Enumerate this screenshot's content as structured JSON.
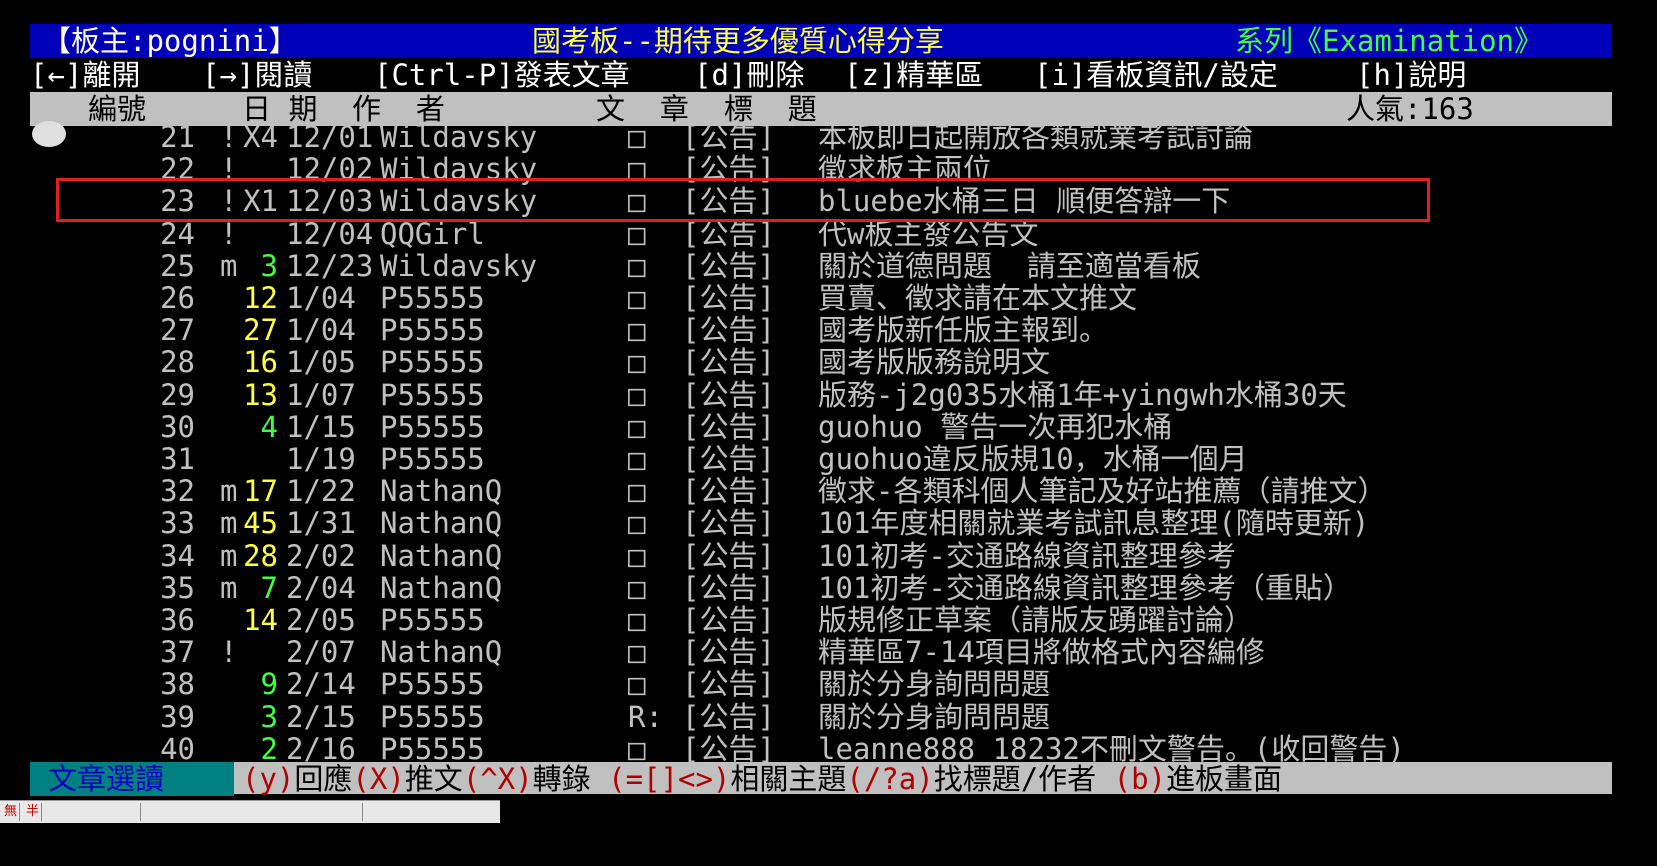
{
  "header": {
    "board": "【板主:pognini】",
    "title": "國考板--期待更多優質心得分享",
    "series": "系列《Examination》"
  },
  "menu": {
    "leave": "[←]離開",
    "read": "[→]閱讀",
    "post": "[Ctrl-P]發表文章",
    "del": "[d]刪除",
    "digest": "[z]精華區",
    "info": "[i]看板資訊/設定",
    "help": "[h]說明"
  },
  "columns": {
    "number": "編號",
    "date": "日 期",
    "author": "作  者",
    "title": "文  章  標  題",
    "popularity": "人氣:163"
  },
  "rows": [
    {
      "num": "21",
      "mark": "!",
      "push": "X4",
      "push_color": "gray",
      "date": "12/01",
      "author": "Wildavsky",
      "box": "□",
      "tag": "[公告]",
      "title": "本板即日起開放各類就業考試討論"
    },
    {
      "num": "22",
      "mark": "!",
      "push": "",
      "push_color": "gray",
      "date": "12/02",
      "author": "Wildavsky",
      "box": "□",
      "tag": "[公告]",
      "title": "徵求板主兩位"
    },
    {
      "num": "23",
      "mark": "!",
      "push": "X1",
      "push_color": "gray",
      "date": "12/03",
      "author": "Wildavsky",
      "box": "□",
      "tag": "[公告]",
      "title": "bluebe水桶三日 順便答辯一下"
    },
    {
      "num": "24",
      "mark": "!",
      "push": "",
      "push_color": "gray",
      "date": "12/04",
      "author": "QQGirl",
      "box": "□",
      "tag": "[公告]",
      "title": "代w板主發公告文"
    },
    {
      "num": "25",
      "mark": "m",
      "push": "3",
      "push_color": "green",
      "date": "12/23",
      "author": "Wildavsky",
      "box": "□",
      "tag": "[公告]",
      "title": "關於道德問題  請至適當看板"
    },
    {
      "num": "26",
      "mark": "",
      "push": "12",
      "push_color": "yellow",
      "date": "1/04",
      "author": "P55555",
      "box": "□",
      "tag": "[公告]",
      "title": "買賣、徵求請在本文推文"
    },
    {
      "num": "27",
      "mark": "",
      "push": "27",
      "push_color": "yellow",
      "date": "1/04",
      "author": "P55555",
      "box": "□",
      "tag": "[公告]",
      "title": "國考版新任版主報到。"
    },
    {
      "num": "28",
      "mark": "",
      "push": "16",
      "push_color": "yellow",
      "date": "1/05",
      "author": "P55555",
      "box": "□",
      "tag": "[公告]",
      "title": "國考版版務說明文"
    },
    {
      "num": "29",
      "mark": "",
      "push": "13",
      "push_color": "yellow",
      "date": "1/07",
      "author": "P55555",
      "box": "□",
      "tag": "[公告]",
      "title": "版務-j2g035水桶1年+yingwh水桶30天"
    },
    {
      "num": "30",
      "mark": "",
      "push": "4",
      "push_color": "green",
      "date": "1/15",
      "author": "P55555",
      "box": "□",
      "tag": "[公告]",
      "title": "guohuo 警告一次再犯水桶"
    },
    {
      "num": "31",
      "mark": "",
      "push": "",
      "push_color": "gray",
      "date": "1/19",
      "author": "P55555",
      "box": "□",
      "tag": "[公告]",
      "title": "guohuo違反版規10，水桶一個月"
    },
    {
      "num": "32",
      "mark": "m",
      "push": "17",
      "push_color": "yellow",
      "date": "1/22",
      "author": "NathanQ",
      "box": "□",
      "tag": "[公告]",
      "title": "徵求-各類科個人筆記及好站推薦（請推文）"
    },
    {
      "num": "33",
      "mark": "m",
      "push": "45",
      "push_color": "yellow",
      "date": "1/31",
      "author": "NathanQ",
      "box": "□",
      "tag": "[公告]",
      "title": "101年度相關就業考試訊息整理(隨時更新)"
    },
    {
      "num": "34",
      "mark": "m",
      "push": "28",
      "push_color": "yellow",
      "date": "2/02",
      "author": "NathanQ",
      "box": "□",
      "tag": "[公告]",
      "title": "101初考-交通路線資訊整理參考"
    },
    {
      "num": "35",
      "mark": "m",
      "push": "7",
      "push_color": "green",
      "date": "2/04",
      "author": "NathanQ",
      "box": "□",
      "tag": "[公告]",
      "title": "101初考-交通路線資訊整理參考（重貼）"
    },
    {
      "num": "36",
      "mark": "",
      "push": "14",
      "push_color": "yellow",
      "date": "2/05",
      "author": "P55555",
      "box": "□",
      "tag": "[公告]",
      "title": "版規修正草案（請版友踴躍討論）"
    },
    {
      "num": "37",
      "mark": "!",
      "push": "",
      "push_color": "gray",
      "date": "2/07",
      "author": "NathanQ",
      "box": "□",
      "tag": "[公告]",
      "title": "精華區7-14項目將做格式內容編修"
    },
    {
      "num": "38",
      "mark": "",
      "push": "9",
      "push_color": "green",
      "date": "2/14",
      "author": "P55555",
      "box": "□",
      "tag": "[公告]",
      "title": "關於分身詢問問題"
    },
    {
      "num": "39",
      "mark": "",
      "push": "3",
      "push_color": "green",
      "date": "2/15",
      "author": "P55555",
      "box": "R:",
      "tag": "[公告]",
      "title": "關於分身詢問問題"
    },
    {
      "num": "40",
      "mark": "",
      "push": "2",
      "push_color": "green",
      "date": "2/16",
      "author": "P55555",
      "box": "□",
      "tag": "[公告]",
      "title": "leanne888 18232不刪文警告。(收回警告)"
    }
  ],
  "footer": {
    "mode": "文章選讀",
    "reply_key": "(y)",
    "reply": "回應",
    "recommend_key": "(X)",
    "recommend": "推文",
    "forward_key": "(^X)",
    "forward": "轉錄",
    "related_key": "(=[]<>)",
    "related": "相關主題",
    "search_key": "(/?a)",
    "search": "找標題/作者",
    "enter_key": "(b)",
    "enter": "進板畫面"
  },
  "ime": {
    "mode1": "無",
    "mode2": "半"
  }
}
